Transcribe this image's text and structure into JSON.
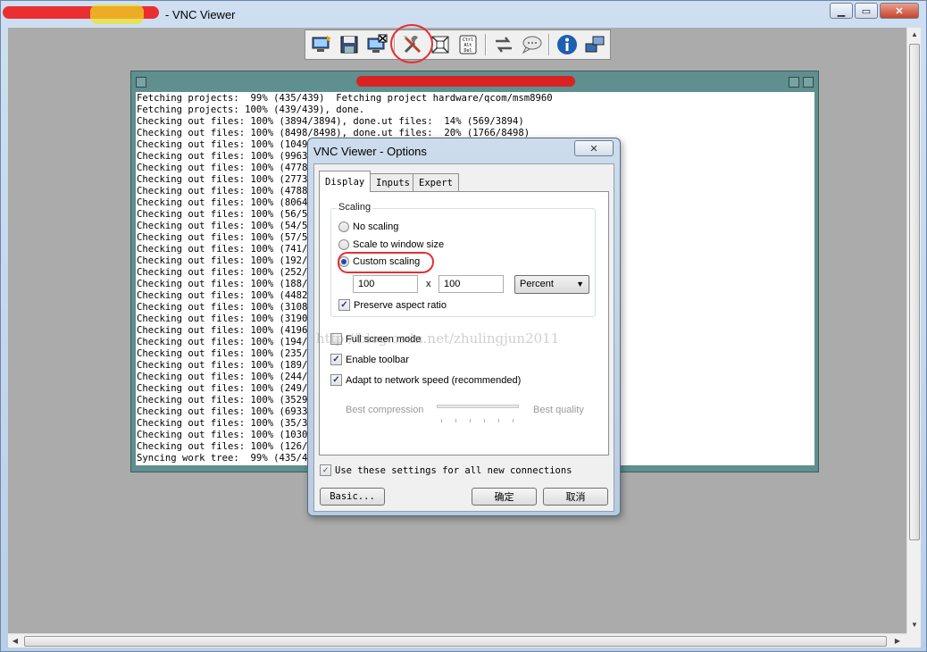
{
  "window": {
    "title": "- VNC Viewer",
    "controls": {
      "minimize": "▁",
      "maximize": "▭",
      "close": "✕"
    }
  },
  "toolbar": {
    "buttons": [
      {
        "name": "new-connection-icon"
      },
      {
        "name": "save-icon"
      },
      {
        "name": "disconnect-icon"
      },
      {
        "name": "options-tools-icon"
      },
      {
        "name": "fullscreen-icon"
      },
      {
        "name": "ctrl-alt-del-icon",
        "label": "Ctrl Alt Del"
      },
      {
        "name": "transfer-icon"
      },
      {
        "name": "chat-icon"
      },
      {
        "name": "info-icon"
      },
      {
        "name": "connection-icon"
      }
    ]
  },
  "terminal": {
    "lines": [
      "Fetching projects:  99% (435/439)  Fetching project hardware/qcom/msm8960",
      "Fetching projects: 100% (439/439), done.",
      "Checking out files: 100% (3894/3894), done.ut files:  14% (569/3894)",
      "Checking out files: 100% (8498/8498), done.ut files:  20% (1766/8498)",
      "Checking out files: 100% (10496/",
      "Checking out files: 100% (99636/",
      "Checking out files: 100% (4778/4",
      "Checking out files: 100% (27735/",
      "Checking out files: 100% (47887/",
      "Checking out files: 100% (8064/8",
      "Checking out files: 100% (56/56)",
      "Checking out files: 100% (54/54)",
      "Checking out files: 100% (57/57)",
      "Checking out files: 100% (741/74",
      "Checking out files: 100% (192/19",
      "Checking out files: 100% (252/25",
      "Checking out files: 100% (188/18",
      "Checking out files: 100% (4482/4",
      "Checking out files: 100% (3108/3",
      "Checking out files: 100% (3190/3",
      "Checking out files: 100% (4196/4",
      "Checking out files: 100% (194/19",
      "Checking out files: 100% (235/23",
      "Checking out files: 100% (189/18",
      "Checking out files: 100% (244/24",
      "Checking out files: 100% (249/24",
      "Checking out files: 100% (3529/3",
      "Checking out files: 100% (69331/",
      "Checking out files: 100% (35/35)",
      "Checking out files: 100% (1030/1",
      "Checking out files: 100% (126/12",
      "Syncing work tree:  99% (435/439"
    ]
  },
  "dialog": {
    "title": "VNC Viewer - Options",
    "close": "✕",
    "tabs": [
      "Display",
      "Inputs",
      "Expert"
    ],
    "scaling": {
      "legend": "Scaling",
      "options": [
        "No scaling",
        "Scale to window size",
        "Custom scaling"
      ],
      "width": "100",
      "x": "x",
      "height": "100",
      "unit": "Percent",
      "preserve": "Preserve aspect ratio"
    },
    "full_screen": "Full screen mode",
    "enable_toolbar": "Enable toolbar",
    "adapt_speed": "Adapt to network speed (recommended)",
    "best_compression": "Best compression",
    "best_quality": "Best quality",
    "use_settings": "Use these settings for all new connections",
    "basic_button": "Basic...",
    "ok_button": "确定",
    "cancel_button": "取消"
  },
  "watermark": "http://blog.csdn.net/zhulingjun2011",
  "colors": {
    "terminal_frame": "#5f8f8f",
    "annotation_red": "#e53030",
    "dialog_chrome": "#cddcec"
  }
}
